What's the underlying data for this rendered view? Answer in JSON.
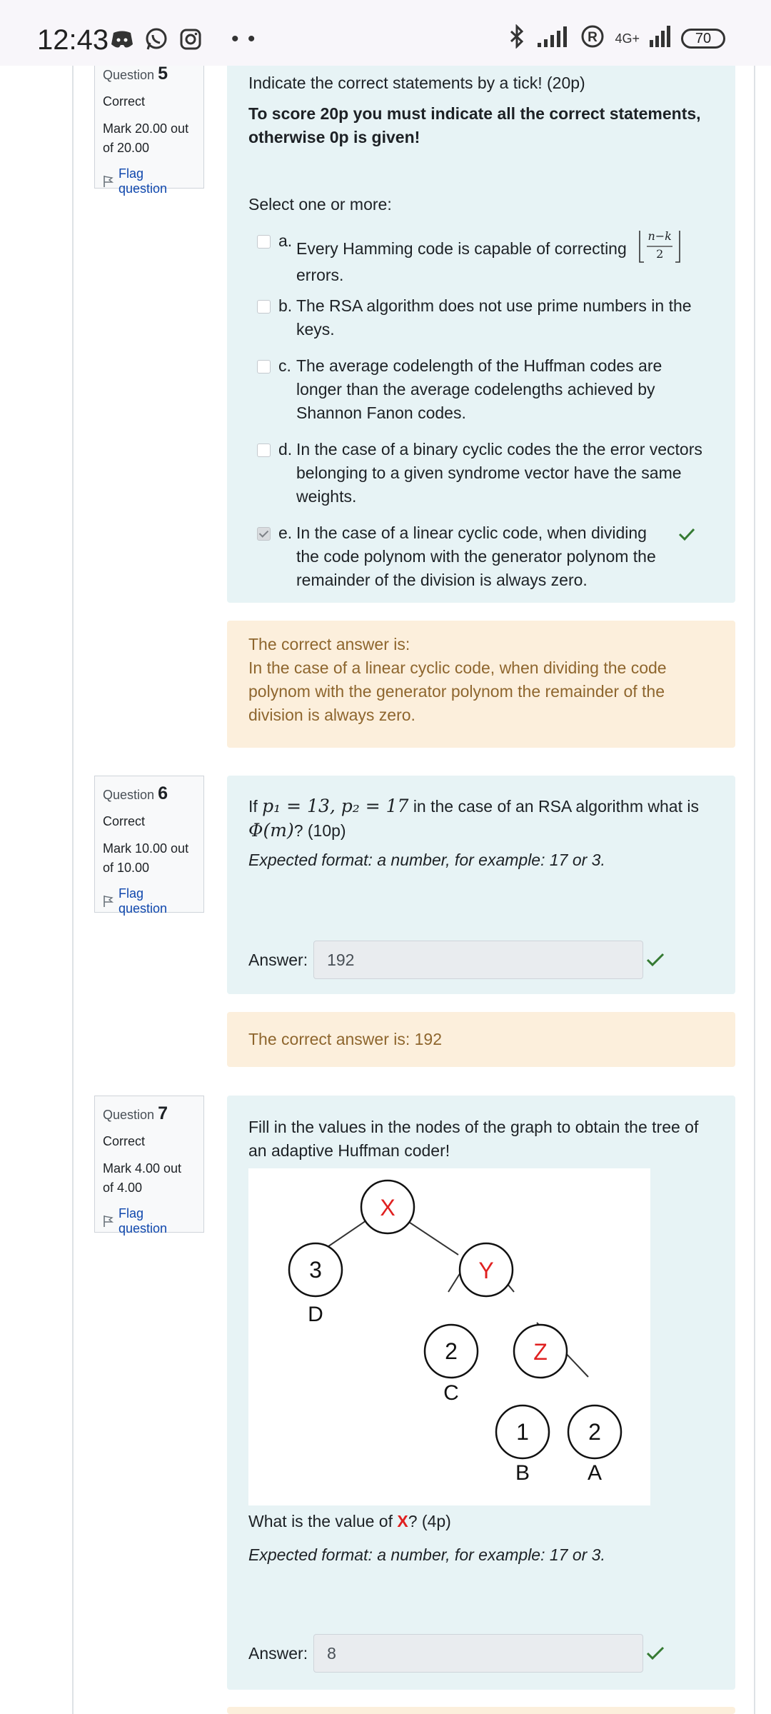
{
  "status_bar": {
    "time": "12:43",
    "network": "4G+",
    "battery": "70",
    "icons_left": [
      "discord-icon",
      "whatsapp-icon",
      "instagram-icon"
    ],
    "icons_right": [
      "bluetooth-icon",
      "signal-icon",
      "registered-icon",
      "signal-icon"
    ]
  },
  "colors": {
    "question_bg": "#e7f3f5",
    "feedback_bg": "#fcefdc",
    "feedback_text": "#8e662e",
    "correct_tick": "#357a32",
    "flag_link": "#0f47ad",
    "red_label": "#e02020"
  },
  "q5": {
    "question_label": "Question",
    "number": "5",
    "state": "Correct",
    "grade": "Mark 20.00 out of 20.00",
    "flag": "Flag question",
    "prompt": "Indicate the correct statements by a tick! (20p)",
    "instruction": "To score 20p you must indicate all the correct statements, otherwise 0p is given!",
    "select_label": "Select one or more:",
    "options": [
      {
        "letter": "a.",
        "text": "Every Hamming code is capable of correcting",
        "formula_num": "n−k",
        "formula_den": "2",
        "text_after": "errors.",
        "checked": false
      },
      {
        "letter": "b.",
        "text": "The RSA algorithm does not use prime numbers in the keys.",
        "checked": false
      },
      {
        "letter": "c.",
        "text": "The average codelength of the Huffman codes are longer than the average codelengths achieved by Shannon Fanon codes.",
        "checked": false
      },
      {
        "letter": "d.",
        "text": "In the case of a binary cyclic codes the the error vectors belonging to a given syndrome vector have the same weights.",
        "checked": false
      },
      {
        "letter": "e.",
        "text": "In the case of a linear cyclic code, when dividing the code polynom with the generator polynom the remainder of the division is always zero.",
        "checked": true
      }
    ],
    "feedback_title": "The correct answer is:",
    "feedback_text": "In the case of a linear cyclic code, when dividing the code polynom with the generator polynom the remainder of the division is always zero."
  },
  "q6": {
    "question_label": "Question",
    "number": "6",
    "state": "Correct",
    "grade": "Mark 10.00 out of 10.00",
    "flag": "Flag question",
    "prompt_prefix": "If",
    "prompt_math": "p₁ = 13, p₂ = 17",
    "prompt_suffix": "in the case of an RSA algorithm what is",
    "prompt_math2": "Φ(m)",
    "prompt_end": "? (10p)",
    "expected": "Expected format: a number, for example: 17 or 3.",
    "answer_label": "Answer:",
    "answer_value": "192",
    "feedback": "The correct answer is: 192"
  },
  "q7": {
    "question_label": "Question",
    "number": "7",
    "state": "Correct",
    "grade": "Mark 4.00 out of 4.00",
    "flag": "Flag question",
    "prompt": "Fill in the values in the nodes of the graph to obtain the tree of an adaptive Huffman coder!",
    "graph": {
      "nodes": [
        {
          "id": "root",
          "label": "X",
          "red": true
        },
        {
          "id": "d",
          "label": "3",
          "leaf": "D"
        },
        {
          "id": "y",
          "label": "Y",
          "red": true
        },
        {
          "id": "c",
          "label": "2",
          "leaf": "C"
        },
        {
          "id": "z",
          "label": "Z",
          "red": true
        },
        {
          "id": "b",
          "label": "1",
          "leaf": "B"
        },
        {
          "id": "a",
          "label": "2",
          "leaf": "A"
        }
      ]
    },
    "subq_prefix": "What is the value of ",
    "subq_mark": "X",
    "subq_suffix": "? (4p)",
    "expected": "Expected format: a number, for example: 17 or 3.",
    "answer_label": "Answer:",
    "answer_value": "8"
  }
}
